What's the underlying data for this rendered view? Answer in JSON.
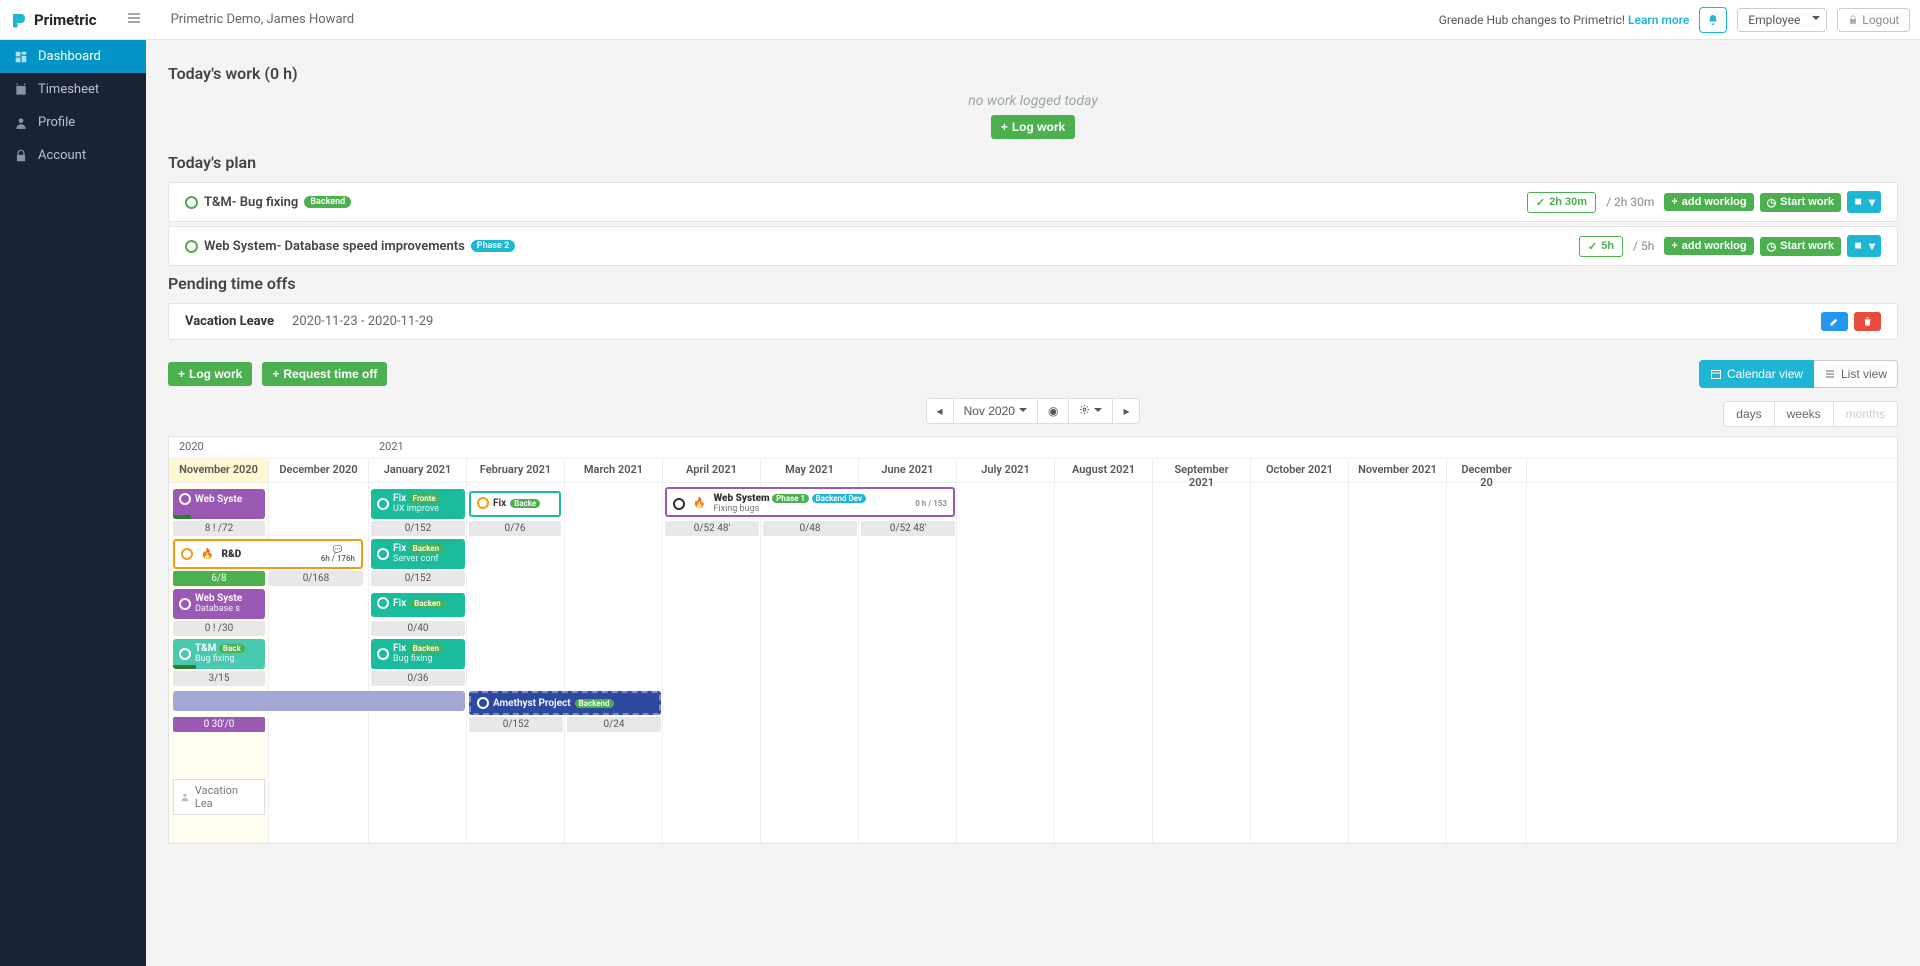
{
  "brand": "Primetric",
  "breadcrumb": "Primetric Demo, James Howard",
  "announcement": {
    "text": "Grenade Hub changes to Primetric!",
    "link": "Learn more"
  },
  "role": "Employee",
  "logout": "Logout",
  "sidebar": [
    {
      "label": "Dashboard",
      "active": true
    },
    {
      "label": "Timesheet"
    },
    {
      "label": "Profile"
    },
    {
      "label": "Account"
    }
  ],
  "sections": {
    "todays_work": "Today's work (0 h)",
    "no_work": "no work logged today",
    "log_work_btn": "Log work",
    "todays_plan": "Today's plan",
    "pending": "Pending time offs"
  },
  "plan": [
    {
      "title": "T&M- Bug fixing",
      "badge": "Backend",
      "time": "2h 30m",
      "total": "2h 30m"
    },
    {
      "title": "Web System- Database speed improvements",
      "badge": "Phase 2",
      "time": "5h",
      "total": "5h"
    }
  ],
  "plan_actions": {
    "add": "add worklog",
    "start": "Start work"
  },
  "timeoff": {
    "name": "Vacation Leave",
    "range": "2020-11-23 - 2020-11-29"
  },
  "action_buttons": {
    "log_work": "Log work",
    "request": "Request time off",
    "calendar": "Calendar view",
    "list": "List view"
  },
  "date_nav": {
    "label": "Nov 2020"
  },
  "granularity": {
    "days": "days",
    "weeks": "weeks",
    "months": "months"
  },
  "years": {
    "y1": "2020",
    "y2": "2021"
  },
  "months": [
    "November 2020",
    "December 2020",
    "January 2021",
    "February 2021",
    "March 2021",
    "April 2021",
    "May 2021",
    "June 2021",
    "July 2021",
    "August 2021",
    "September 2021",
    "October 2021",
    "November 2021",
    "December 20"
  ],
  "tasks": {
    "websys1": {
      "name": "Web Syste",
      "meta": "8 ! /72"
    },
    "rd": {
      "name": "R&D",
      "meta1": "6/8",
      "meta2": "0/168",
      "hrs": "6h / 176h"
    },
    "websys2": {
      "name": "Web Syste",
      "sub": "Database s",
      "meta": "0 ! /30"
    },
    "tm": {
      "name": "T&M",
      "sub": "Bug fixing",
      "badge": "Back",
      "meta": "3/15"
    },
    "fix1": {
      "name": "Fix",
      "sub": "UX improve",
      "badge": "Fronte",
      "meta": "0/152"
    },
    "fix2": {
      "name": "Fix",
      "sub": "Server conf",
      "badge": "Backen",
      "meta": "0/152"
    },
    "fix3": {
      "name": "Fix",
      "meta": "0/40",
      "badge": "Backen"
    },
    "fix4": {
      "name": "Fix",
      "sub": "Bug fixing",
      "badge": "Backen",
      "meta": "0/36"
    },
    "fix5": {
      "name": "Fix",
      "badge": "Backe",
      "meta": "0/76"
    },
    "websys3": {
      "name": "Web System",
      "sub": "Fixing bugs",
      "p1": "Phase 1",
      "p2": "Backend Dev",
      "hrs": "0 h / 153",
      "m1": "0/52 48'",
      "m2": "0/48",
      "m3": "0/52 48'"
    },
    "amethyst": {
      "name": "Amethyst Project",
      "badge": "Backend",
      "m1": "0/152",
      "m2": "0/24"
    },
    "purple_meta": "0 30'/0",
    "vacation": "Vacation Lea"
  }
}
